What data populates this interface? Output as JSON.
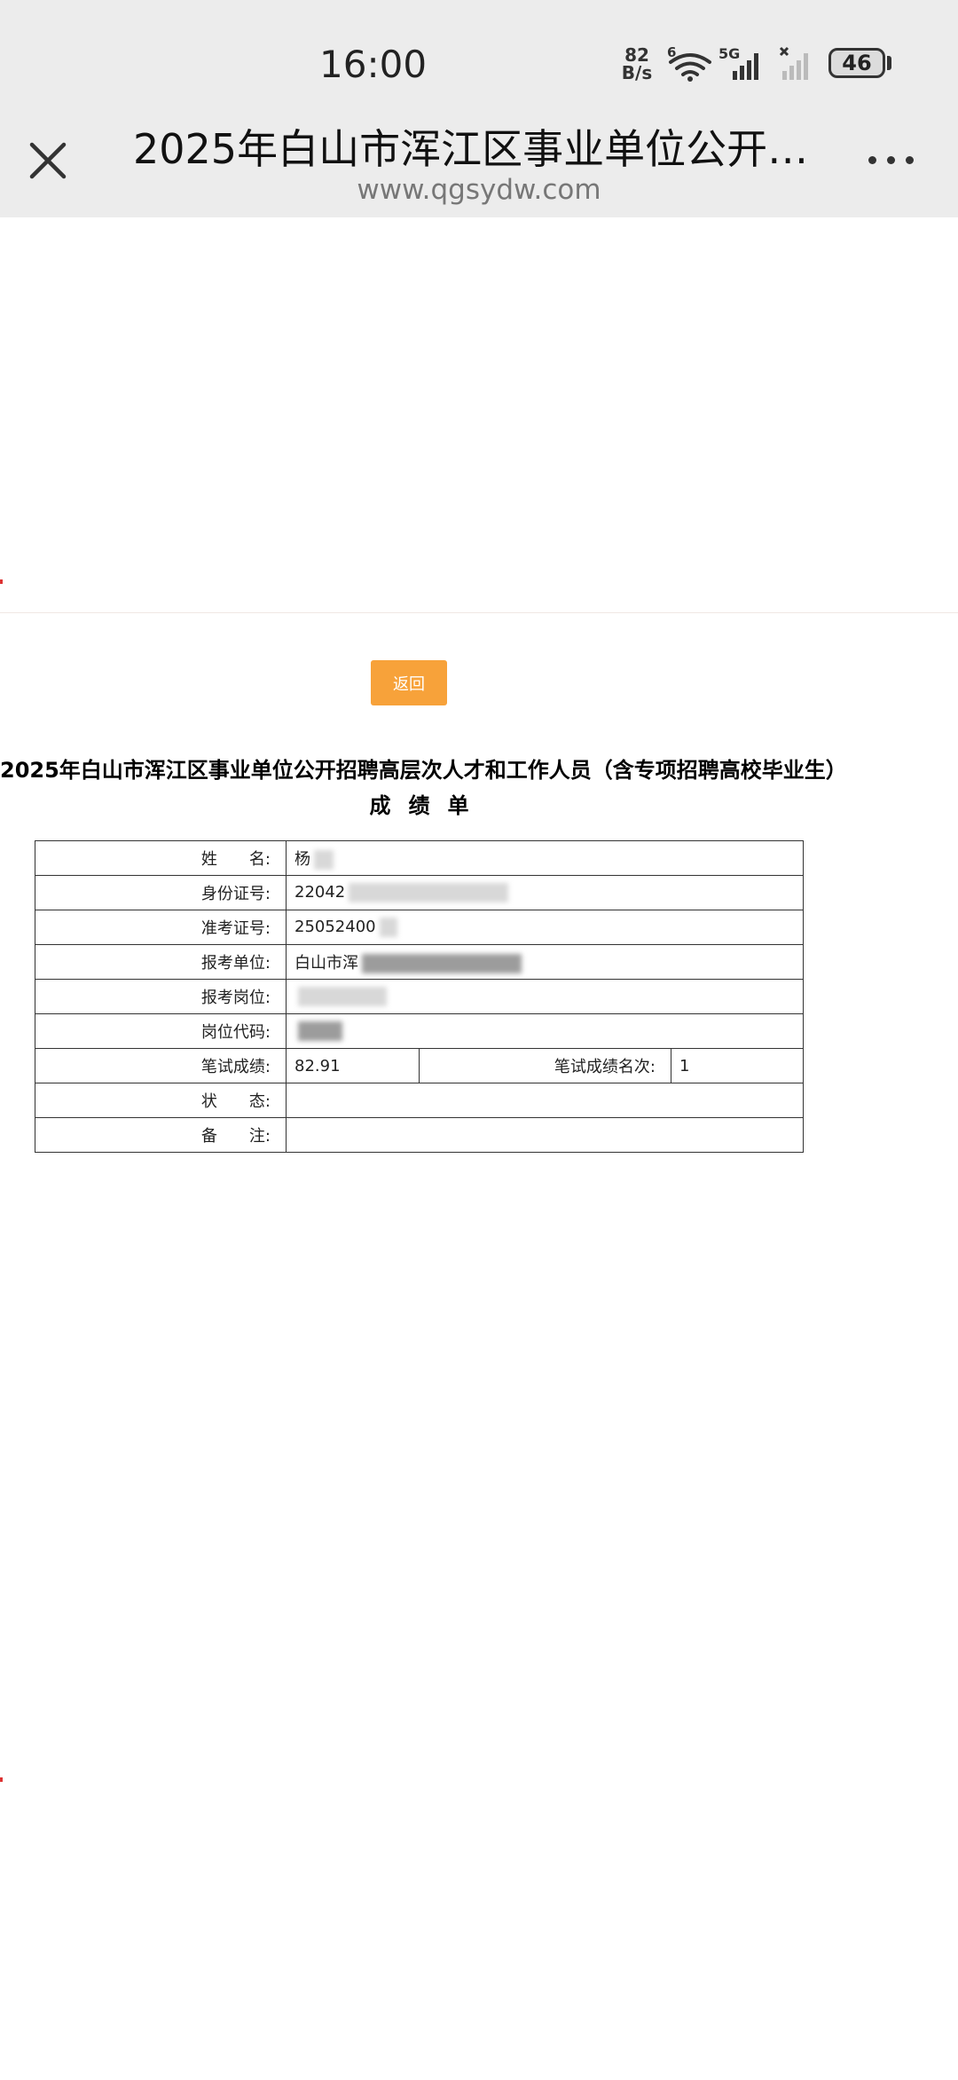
{
  "status_bar": {
    "time": "16:00",
    "net_speed_value": "82",
    "net_speed_unit": "B/s",
    "wifi_badge": "6",
    "cell_badge": "5G",
    "battery": "46"
  },
  "browser": {
    "title": "2025年白山市浑江区事业单位公开…",
    "url": "www.qgsydw.com"
  },
  "page": {
    "back_label": "返回",
    "doc_title": "2025年白山市浑江区事业单位公开招聘高层次人才和工作人员（含专项招聘高校毕业生）",
    "doc_subtitle": "成绩单"
  },
  "score_sheet": {
    "name_label": "姓　　名:",
    "name_value": "杨",
    "id_label": "身份证号:",
    "id_value": "22042",
    "ticket_label": "准考证号:",
    "ticket_value": "25052400",
    "unit_label": "报考单位:",
    "unit_value": "白山市浑",
    "post_label": "报考岗位:",
    "post_value": "",
    "code_label": "岗位代码:",
    "code_value": "",
    "written_score_label": "笔试成绩:",
    "written_score_value": "82.91",
    "written_rank_label": "笔试成绩名次:",
    "written_rank_value": "1",
    "status_label": "状　　态:",
    "status_value": "",
    "remark_label": "备　　注:",
    "remark_value": ""
  },
  "icons": {
    "close": "close-icon",
    "more": "more-icon",
    "wifi": "wifi-icon",
    "signal": "signal-icon",
    "battery": "battery-icon"
  },
  "colors": {
    "header_bg": "#ececec",
    "back_button": "#f7a23a"
  }
}
